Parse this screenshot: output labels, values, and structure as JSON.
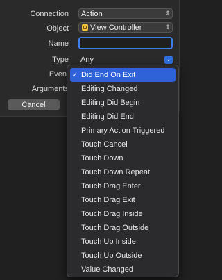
{
  "connection": {
    "label": "Connection",
    "value": "Action"
  },
  "object": {
    "label": "Object",
    "value": "View Controller",
    "icon": "view-controller-icon",
    "icon_color": "#f6c33b"
  },
  "name": {
    "label": "Name",
    "value": ""
  },
  "type": {
    "label": "Type",
    "value": "Any"
  },
  "event": {
    "label": "Event"
  },
  "arguments": {
    "label": "Arguments"
  },
  "cancel_label": "Cancel",
  "accent": "#2f62d9",
  "event_menu": {
    "selected_index": 0,
    "items": [
      {
        "label": "Did End On Exit"
      },
      {
        "label": "Editing Changed"
      },
      {
        "label": "Editing Did Begin"
      },
      {
        "label": "Editing Did End"
      },
      {
        "label": "Primary Action Triggered"
      },
      {
        "label": "Touch Cancel"
      },
      {
        "label": "Touch Down"
      },
      {
        "label": "Touch Down Repeat"
      },
      {
        "label": "Touch Drag Enter"
      },
      {
        "label": "Touch Drag Exit"
      },
      {
        "label": "Touch Drag Inside"
      },
      {
        "label": "Touch Drag Outside"
      },
      {
        "label": "Touch Up Inside"
      },
      {
        "label": "Touch Up Outside"
      },
      {
        "label": "Value Changed"
      }
    ]
  }
}
